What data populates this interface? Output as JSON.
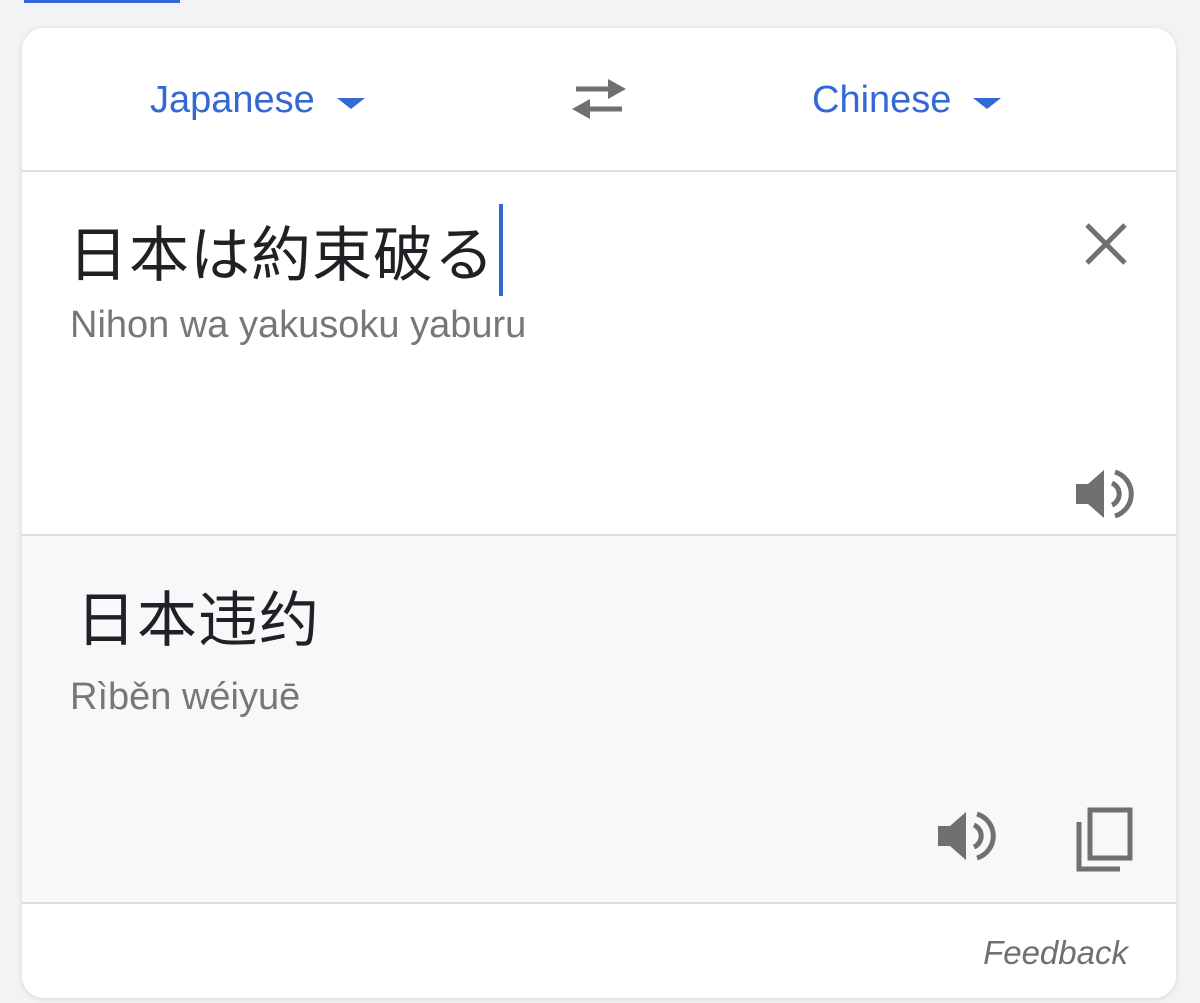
{
  "languages": {
    "source": {
      "label": "Japanese"
    },
    "target": {
      "label": "Chinese"
    }
  },
  "source": {
    "text": "日本は約束破る",
    "transliteration": "Nihon wa yakusoku yaburu"
  },
  "result": {
    "text": "日本违约",
    "transliteration": "Rìběn wéiyuē"
  },
  "footer": {
    "feedback_label": "Feedback"
  },
  "icons": {
    "language_dropdown": "chevron-down-icon",
    "swap": "swap-arrows-icon",
    "clear": "close-icon",
    "listen": "speaker-icon",
    "copy": "copy-icon"
  },
  "colors": {
    "accent": "#3468d4",
    "icon_gray": "#707070",
    "result_background": "#f8f8fa",
    "page_background": "#f1f3f4"
  }
}
